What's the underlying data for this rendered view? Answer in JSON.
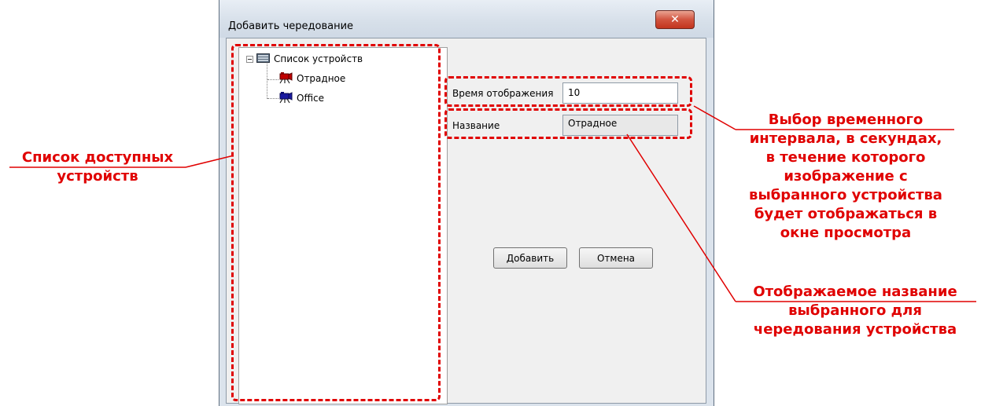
{
  "dialog": {
    "title": "Добавить чередование",
    "close_glyph": "✕",
    "tree": {
      "root_label": "Список устройств",
      "items": [
        {
          "label": "Отрадное",
          "icon": "camera-red-icon",
          "color": "#c00000"
        },
        {
          "label": "Office",
          "icon": "camera-blue-icon",
          "color": "#1a1aa0"
        }
      ]
    },
    "display_time": {
      "label": "Время отображения",
      "value": "10"
    },
    "name": {
      "label": "Название",
      "value": "Отрадное"
    },
    "buttons": {
      "add": "Добавить",
      "cancel": "Отмена"
    }
  },
  "annotations": {
    "device_list": [
      "Список доступных",
      "устройств"
    ],
    "time_interval": [
      "Выбор временного",
      "интервала, в секундах,",
      "в течение которого",
      "изображение с",
      "выбранного устройства",
      "будет отображаться в",
      "окне просмотра"
    ],
    "display_name": [
      "Отображаемое название",
      "выбранного для",
      "чередования устройства"
    ]
  },
  "colors": {
    "annotation": "#e00000"
  }
}
